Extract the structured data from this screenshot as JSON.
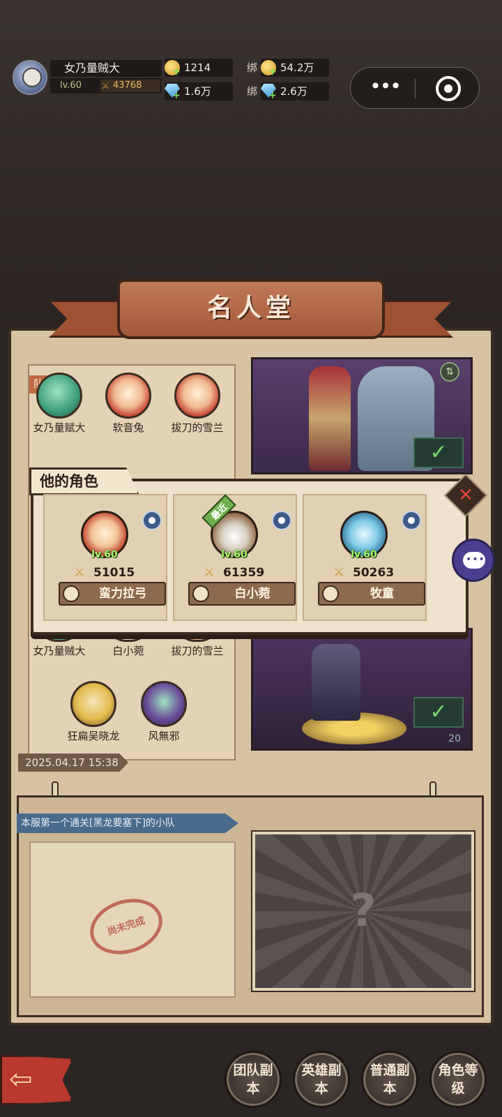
{
  "player": {
    "name": "女乃量贼大",
    "level": "lv.60",
    "power": "43768"
  },
  "resources": {
    "gold": "1214",
    "diamond": "1.6万",
    "bind_label": "绑",
    "bound_gold": "54.2万",
    "bound_diamond": "2.6万"
  },
  "capsule": {
    "more": "•••"
  },
  "hall": {
    "title": "名人堂",
    "team_tag": "队",
    "team1": [
      "女乃量赋大",
      "软音兔",
      "拔刀的雪兰"
    ],
    "team2": [
      "女乃量贼大",
      "白小菀",
      "拔刀的雪兰",
      "狂扁吴晓龙",
      "风無邪"
    ],
    "date": "2025.04.17 15:38",
    "scene2_count": "20",
    "lower_caption": "本服第一个通关[黑龙要塞下]的小队",
    "stamp": "尚未完成",
    "unknown_mark": "?"
  },
  "popup": {
    "title": "他的角色",
    "close": "✕",
    "recent_label": "最近",
    "characters": [
      {
        "level": "lv.60",
        "power": "51015",
        "class": "蛮力拉弓"
      },
      {
        "level": "lv.60",
        "power": "61359",
        "class": "白小菀"
      },
      {
        "level": "lv.60",
        "power": "50263",
        "class": "牧童"
      }
    ]
  },
  "nav": {
    "back": "⇦",
    "buttons": [
      "团队副本",
      "英雄副本",
      "普通副本",
      "角色等级"
    ]
  }
}
